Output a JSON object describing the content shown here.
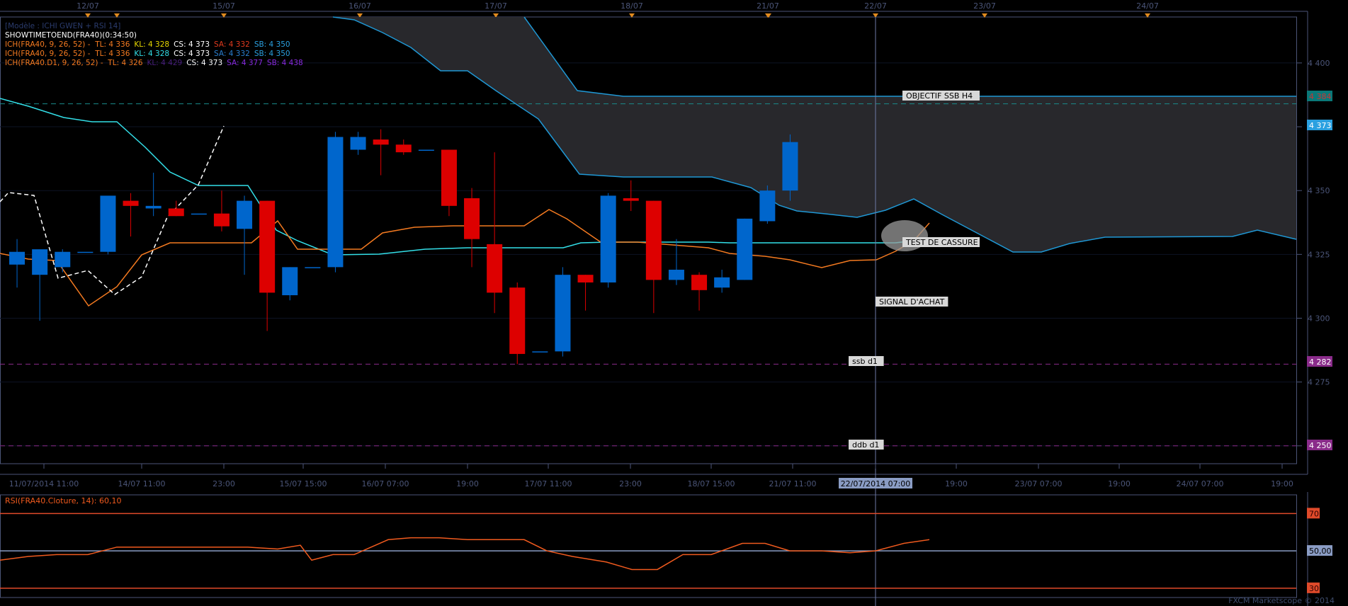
{
  "top_dates": [
    "12/07",
    "15/07",
    "16/07",
    "17/07",
    "18/07",
    "21/07",
    "22/07",
    "23/07",
    "24/07"
  ],
  "indicator_lines": [
    {
      "name": "model-line",
      "parts": [
        {
          "text": "[Modèle : ICHI GWEN + RSI 14]",
          "color": "#2b3c6e"
        }
      ]
    },
    {
      "name": "showtime-line",
      "parts": [
        {
          "text": "SHOWTIMETOEND(FRA40)(0:34:50)",
          "color": "#ffffff"
        }
      ]
    },
    {
      "name": "ich-h1-line",
      "parts": [
        {
          "text": "ICH(FRA40, 9, 26, 52) -  TL: 4 336",
          "color": "#f47a20"
        },
        {
          "text": "KL: 4 328",
          "color": "#e6d600"
        },
        {
          "text": "CS: 4 373",
          "color": "#ffffff"
        },
        {
          "text": "SA: 4 332",
          "color": "#e03a1e"
        },
        {
          "text": "SB: 4 350",
          "color": "#2aa0e0"
        }
      ]
    },
    {
      "name": "ich-h4-line",
      "parts": [
        {
          "text": "ICH(FRA40, 9, 26, 52) -  TL: 4 336",
          "color": "#f47a20"
        },
        {
          "text": "KL: 4 328",
          "color": "#33dfe8"
        },
        {
          "text": "CS: 4 373",
          "color": "#ffffff"
        },
        {
          "text": "SA: 4 332",
          "color": "#2a7fd0"
        },
        {
          "text": "SB: 4 350",
          "color": "#2aa0e0"
        }
      ]
    },
    {
      "name": "ich-d1-line",
      "parts": [
        {
          "text": "ICH(FRA40.D1, 9, 26, 52) -  TL: 4 326",
          "color": "#f47a20"
        },
        {
          "text": "KL: 4 429",
          "color": "#4a1f7c"
        },
        {
          "text": "CS: 4 373",
          "color": "#ffffff"
        },
        {
          "text": "SA: 4 377",
          "color": "#8a2be2"
        },
        {
          "text": "SB: 4 438",
          "color": "#8a2be2"
        }
      ]
    }
  ],
  "annotations": {
    "objectif": "OBJECTIF SSB H4",
    "test": "TEST DE CASSURE",
    "signal": "SIGNAL D'ACHAT",
    "ssb": "ssb d1",
    "ddb": "ddb d1"
  },
  "price_labels": {
    "ssb_h4": "4 384",
    "last": "4 373",
    "ssb_d1": "4 282",
    "ddb_d1": "4 250"
  },
  "rsi_label": "RSI(FRA40.Cloture, 14): 60,10",
  "watermark": "FXCM Marketscope © 2014",
  "colors": {
    "bull": "#0066cc",
    "bear": "#dd0000",
    "tenkan": "#f47a20",
    "kijun": "#33dfe8",
    "cloud_line": "#1f97d4",
    "cloud_fill": "#2a2a2e",
    "grid": "#0d1324",
    "axis": "#4b5578",
    "rsi_line": "#f05a1e"
  },
  "chart_data": {
    "type": "candlestick",
    "instrument": "FRA40",
    "x_ticks": [
      "11/07/2014 11:00",
      "14/07 11:00",
      "23:00",
      "15/07 15:00",
      "16/07 07:00",
      "19:00",
      "17/07 11:00",
      "23:00",
      "18/07 15:00",
      "21/07 11:00",
      "22/07/2014 07:00",
      "19:00",
      "23/07 07:00",
      "19:00",
      "24/07 07:00",
      "19:00"
    ],
    "y_ticks": [
      4400,
      4375,
      4350,
      4325,
      4300,
      4275,
      4250
    ],
    "ylim": [
      4243,
      4418
    ],
    "candles": [
      {
        "o": 4321,
        "h": 4331,
        "l": 4312,
        "c": 4326
      },
      {
        "o": 4317,
        "h": 4319,
        "l": 4299,
        "c": 4327
      },
      {
        "o": 4320,
        "h": 4327,
        "l": 4318,
        "c": 4326
      },
      {
        "o": 4326,
        "h": 4326,
        "l": 4326,
        "c": 4326
      },
      {
        "o": 4326,
        "h": 4347,
        "l": 4325,
        "c": 4348
      },
      {
        "o": 4346,
        "h": 4349,
        "l": 4332,
        "c": 4344
      },
      {
        "o": 4343,
        "h": 4357,
        "l": 4340,
        "c": 4344
      },
      {
        "o": 4343,
        "h": 4346,
        "l": 4340,
        "c": 4340
      },
      {
        "o": 4341,
        "h": 4341,
        "l": 4341,
        "c": 4341
      },
      {
        "o": 4341,
        "h": 4350,
        "l": 4334,
        "c": 4336
      },
      {
        "o": 4335,
        "h": 4348,
        "l": 4317,
        "c": 4346
      },
      {
        "o": 4346,
        "h": 4346,
        "l": 4295,
        "c": 4310
      },
      {
        "o": 4309,
        "h": 4320,
        "l": 4307,
        "c": 4320
      },
      {
        "o": 4320,
        "h": 4320,
        "l": 4320,
        "c": 4320
      },
      {
        "o": 4320,
        "h": 4373,
        "l": 4318,
        "c": 4371
      },
      {
        "o": 4366,
        "h": 4373,
        "l": 4364,
        "c": 4371
      },
      {
        "o": 4370,
        "h": 4374,
        "l": 4356,
        "c": 4368
      },
      {
        "o": 4368,
        "h": 4370,
        "l": 4364,
        "c": 4365
      },
      {
        "o": 4366,
        "h": 4366,
        "l": 4366,
        "c": 4366
      },
      {
        "o": 4366,
        "h": 4366,
        "l": 4340,
        "c": 4344
      },
      {
        "o": 4347,
        "h": 4351,
        "l": 4320,
        "c": 4331
      },
      {
        "o": 4329,
        "h": 4365,
        "l": 4302,
        "c": 4310
      },
      {
        "o": 4312,
        "h": 4314,
        "l": 4282,
        "c": 4286
      },
      {
        "o": 4287,
        "h": 4287,
        "l": 4287,
        "c": 4287
      },
      {
        "o": 4287,
        "h": 4320,
        "l": 4285,
        "c": 4317
      },
      {
        "o": 4317,
        "h": 4317,
        "l": 4303,
        "c": 4314
      },
      {
        "o": 4314,
        "h": 4349,
        "l": 4312,
        "c": 4348
      },
      {
        "o": 4347,
        "h": 4354,
        "l": 4342,
        "c": 4346
      },
      {
        "o": 4346,
        "h": 4346,
        "l": 4302,
        "c": 4315
      },
      {
        "o": 4315,
        "h": 4331,
        "l": 4313,
        "c": 4319
      },
      {
        "o": 4317,
        "h": 4318,
        "l": 4303,
        "c": 4311
      },
      {
        "o": 4312,
        "h": 4319,
        "l": 4310,
        "c": 4316
      },
      {
        "o": 4315,
        "h": 4339,
        "l": 4315,
        "c": 4339
      },
      {
        "o": 4338,
        "h": 4352,
        "l": 4337,
        "c": 4350
      },
      {
        "o": 4350,
        "h": 4372,
        "l": 4346,
        "c": 4369
      }
    ],
    "tenkan": [
      4322,
      4322,
      4322,
      4311,
      4316,
      4322,
      4324,
      4324,
      4324,
      4324,
      4334,
      4324,
      4324,
      4324,
      4332,
      4333,
      4333,
      4333,
      4333,
      4333,
      4338,
      4335,
      4329,
      4329,
      4329,
      4329,
      4325,
      4325,
      4322,
      4322,
      4319,
      4320,
      4320,
      4324,
      4332
    ],
    "kijun": [
      4373,
      4371,
      4368,
      4365,
      4365,
      4358,
      4349,
      4349,
      4349,
      4349,
      4330,
      4324,
      4324,
      4325,
      4325,
      4325,
      4325,
      4325,
      4325,
      4325,
      4325,
      4325,
      4328,
      4328,
      4328,
      4328,
      4328,
      4328,
      4328,
      4328,
      4328,
      4328,
      4328,
      4328,
      4328
    ],
    "chikou": [
      4340,
      4339,
      4320,
      4322,
      4315,
      4315,
      4318,
      4340,
      4350
    ],
    "cloud_upper": [
      4420,
      4420,
      4419,
      4408,
      4401,
      4392,
      4392,
      4380,
      4356,
      4356,
      4356,
      4356,
      4356,
      4356,
      4356,
      4384,
      4384,
      4384,
      4384,
      4384,
      4384,
      4384,
      4384,
      4384,
      4384,
      4384,
      4384,
      4384,
      4384,
      4384,
      4384,
      4384,
      4384,
      4384,
      4384,
      4384,
      4384,
      4384,
      4384,
      4384,
      4384,
      4384,
      4384,
      4384,
      4384,
      4384,
      4384
    ],
    "cloud_lower": [
      4421,
      4421,
      4416,
      4408,
      4400,
      4392,
      4392,
      4382,
      4380,
      4356,
      4355,
      4355,
      4355,
      4355,
      4355,
      4352,
      4346,
      4340,
      4343,
      4344,
      4341,
      4338,
      4338,
      4338,
      4333,
      4327,
      4324,
      4324,
      4329,
      4330,
      4330,
      4330,
      4330,
      4330,
      4330,
      4333,
      4331
    ],
    "levels": [
      {
        "name": "OBJECTIF SSB H4",
        "value": 4384
      },
      {
        "name": "ssb d1",
        "value": 4282
      },
      {
        "name": "ddb d1",
        "value": 4250
      }
    ],
    "rsi": {
      "name": "RSI(FRA40.Cloture, 14)",
      "ylim": [
        25,
        80
      ],
      "levels": [
        30,
        50,
        70
      ],
      "values": [
        45,
        47,
        48,
        48,
        52,
        52,
        52,
        52,
        52,
        52,
        51,
        53,
        45,
        48,
        48,
        56,
        57,
        57,
        56,
        56,
        56,
        50,
        47,
        44,
        40,
        40,
        48,
        48,
        54,
        54,
        50,
        50,
        49,
        50,
        54,
        56,
        59
      ]
    }
  }
}
